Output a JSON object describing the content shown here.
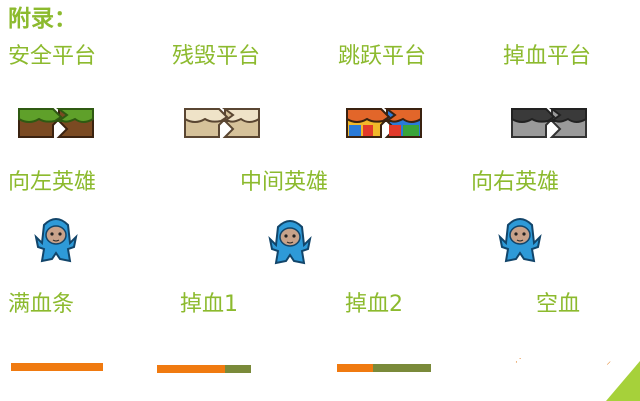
{
  "title": "附录：",
  "platforms": [
    {
      "label": "安全平台",
      "icon": "grass-platform-icon",
      "top": "#5fa02a",
      "body": "#7a4a22"
    },
    {
      "label": "残毁平台",
      "icon": "broken-platform-icon",
      "top": "#e8d8b8",
      "body": "#d6c29a"
    },
    {
      "label": "跳跃平台",
      "icon": "colorful-platform-icon",
      "top": "#e2662a",
      "body": "#f2b82a"
    },
    {
      "label": "掉血平台",
      "icon": "damage-platform-icon",
      "top": "#444444",
      "body": "#9a9a9a"
    }
  ],
  "heroes": [
    {
      "label": "向左英雄",
      "icon": "hero-left-icon"
    },
    {
      "label": "中间英雄",
      "icon": "hero-center-icon"
    },
    {
      "label": "向右英雄",
      "icon": "hero-right-icon"
    }
  ],
  "health": [
    {
      "label": "满血条",
      "fill": 1.0
    },
    {
      "label": "掉血1",
      "fill": 0.72
    },
    {
      "label": "掉血2",
      "fill": 0.38
    },
    {
      "label": "空血",
      "fill": 0.0
    }
  ],
  "colors": {
    "accent_text": "#8cba2e",
    "health_fill": "#f07a10",
    "health_empty": "#7a8a3a",
    "corner": "#a6d13a"
  }
}
